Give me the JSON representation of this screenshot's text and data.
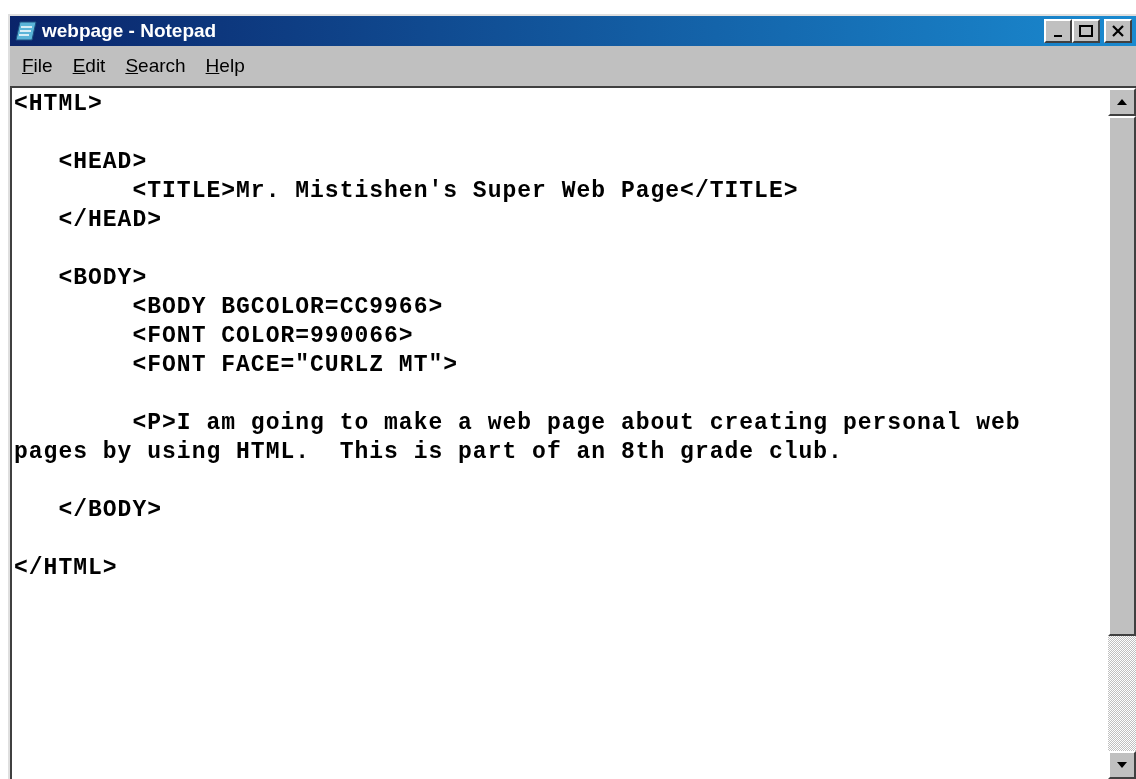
{
  "window": {
    "title": "webpage - Notepad"
  },
  "menu": [
    "File",
    "Edit",
    "Search",
    "Help"
  ],
  "editor": {
    "blocks": [
      [
        "<HTML>"
      ],
      [
        "   <HEAD>",
        "        <TITLE>Mr. Mistishen's Super Web Page</TITLE>",
        "   </HEAD>"
      ],
      [
        "   <BODY>",
        "        <BODY BGCOLOR=CC9966>",
        "        <FONT COLOR=990066>",
        "        <FONT FACE=\"CURLZ MT\">"
      ],
      [
        "        <P>I am going to make a web page about creating personal web",
        "pages by using HTML.  This is part of an 8th grade club."
      ],
      [
        "   </BODY>"
      ],
      [
        "</HTML>"
      ]
    ]
  }
}
